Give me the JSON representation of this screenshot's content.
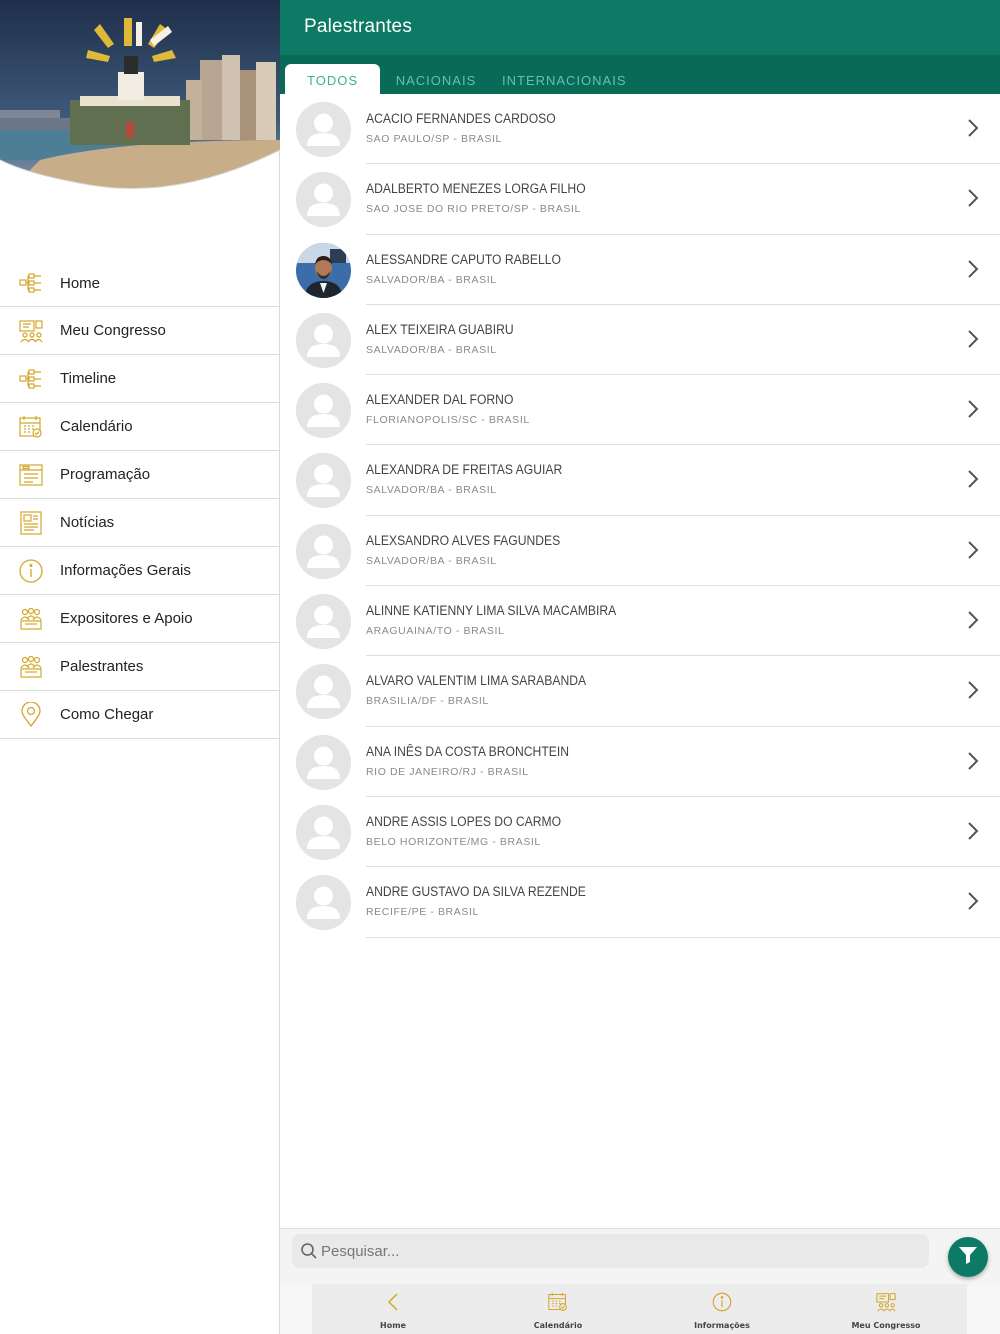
{
  "colors": {
    "primary": "#0d7a66",
    "primary_dark": "#0a6a58",
    "tab_text": "#5fc4ae",
    "icon_gold": "#d4a62a"
  },
  "header": {
    "title": "Palestrantes"
  },
  "tabs": [
    {
      "label": "TODOS",
      "active": true
    },
    {
      "label": "NACIONAIS",
      "active": false
    },
    {
      "label": "INTERNACIONAIS",
      "active": false
    }
  ],
  "sidebar": {
    "items": [
      {
        "label": "Home",
        "icon": "home-flowchart-icon"
      },
      {
        "label": "Meu Congresso",
        "icon": "congress-icon"
      },
      {
        "label": "Timeline",
        "icon": "timeline-icon"
      },
      {
        "label": "Calendário",
        "icon": "calendar-icon"
      },
      {
        "label": "Programação",
        "icon": "schedule-icon"
      },
      {
        "label": "Notícias",
        "icon": "news-icon"
      },
      {
        "label": "Informações Gerais",
        "icon": "info-icon"
      },
      {
        "label": "Expositores e Apoio",
        "icon": "exhibitors-icon"
      },
      {
        "label": "Palestrantes",
        "icon": "speakers-icon"
      },
      {
        "label": "Como Chegar",
        "icon": "location-pin-icon"
      }
    ]
  },
  "speakers": [
    {
      "name": "ACACIO FERNANDES CARDOSO",
      "location": "SAO PAULO/SP - BRASIL",
      "photo": false
    },
    {
      "name": "ADALBERTO MENEZES LORGA FILHO",
      "location": "SAO JOSE DO RIO PRETO/SP - BRASIL",
      "photo": false
    },
    {
      "name": "ALESSANDRE CAPUTO RABELLO",
      "location": "SALVADOR/BA - BRASIL",
      "photo": true
    },
    {
      "name": "ALEX TEIXEIRA GUABIRU",
      "location": "SALVADOR/BA - BRASIL",
      "photo": false
    },
    {
      "name": "ALEXANDER DAL FORNO",
      "location": "FLORIANOPOLIS/SC - BRASIL",
      "photo": false
    },
    {
      "name": "ALEXANDRA DE FREITAS AGUIAR",
      "location": "SALVADOR/BA - BRASIL",
      "photo": false
    },
    {
      "name": "ALEXSANDRO ALVES FAGUNDES",
      "location": "SALVADOR/BA - BRASIL",
      "photo": false
    },
    {
      "name": "ALINNE KATIENNY LIMA SILVA MACAMBIRA",
      "location": "ARAGUAINA/TO - BRASIL",
      "photo": false
    },
    {
      "name": "ALVARO VALENTIM LIMA SARABANDA",
      "location": "BRASILIA/DF - BRASIL",
      "photo": false
    },
    {
      "name": "ANA INÊS DA COSTA BRONCHTEIN",
      "location": "RIO DE JANEIRO/RJ - BRASIL",
      "photo": false
    },
    {
      "name": "ANDRE ASSIS LOPES DO CARMO",
      "location": "BELO HORIZONTE/MG - BRASIL",
      "photo": false
    },
    {
      "name": "ANDRE GUSTAVO DA SILVA REZENDE",
      "location": "RECIFE/PE - BRASIL",
      "photo": false
    }
  ],
  "search": {
    "placeholder": "Pesquisar..."
  },
  "bottom_nav": [
    {
      "label": "Home",
      "icon": "back-chevron-icon"
    },
    {
      "label": "Calendário",
      "icon": "calendar-icon"
    },
    {
      "label": "Informações",
      "icon": "info-icon"
    },
    {
      "label": "Meu Congresso",
      "icon": "congress-icon"
    }
  ]
}
